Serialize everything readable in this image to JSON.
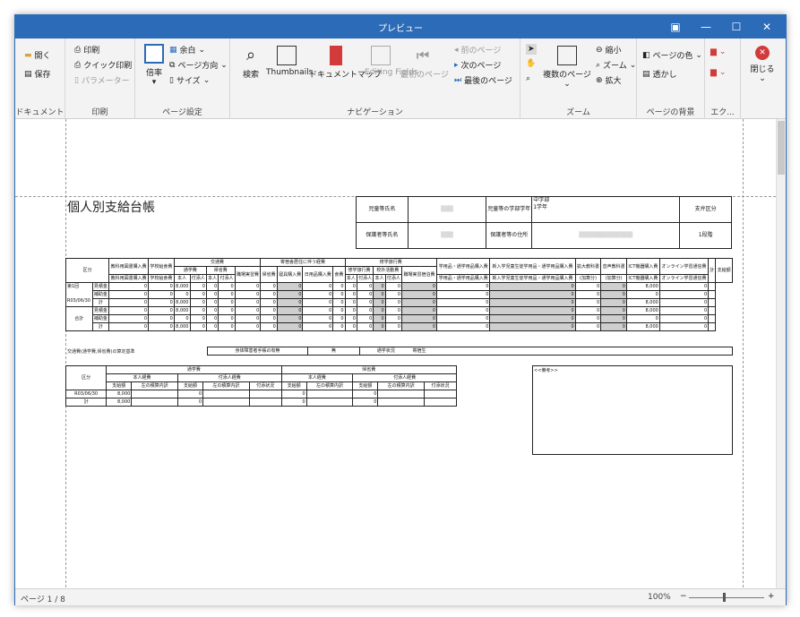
{
  "window": {
    "title": "プレビュー"
  },
  "ribbon": {
    "document": {
      "open": "開く",
      "save": "保存",
      "label": "ドキュメント"
    },
    "print": {
      "print": "印刷",
      "quick_print": "クイック印刷",
      "parameters": "パラメーター",
      "label": "印刷"
    },
    "page_setup": {
      "scale": "倍率",
      "margins": "余白",
      "orientation": "ページ方向",
      "size": "サイズ",
      "label": "ページ設定"
    },
    "navigation": {
      "search": "検索",
      "thumbnails": "Thumbnails",
      "doc_map": "ドキュメントマップ",
      "editing_fields": "Editing Fields",
      "first_page": "最初のページ",
      "prev_page": "前のページ",
      "next_page": "次のページ",
      "last_page": "最後のページ",
      "label": "ナビゲーション"
    },
    "zoom": {
      "multi_page": "複数のページ",
      "zoom_out": "縮小",
      "zoom": "ズーム",
      "zoom_in": "拡大",
      "label": "ズーム"
    },
    "background": {
      "page_color": "ページの色",
      "watermark": "透かし",
      "label": "ページの背景"
    },
    "export": {
      "label": "エク..."
    },
    "close": {
      "label": "閉じる"
    }
  },
  "report": {
    "title": "個人別支給台帳",
    "info": {
      "child_name_label": "児童等氏名",
      "grade_label": "児童等の学部学年",
      "grade_value1": "中学部",
      "grade_value2": "1学年",
      "pay_class_label": "支弁区分",
      "guardian_label": "保護者等氏名",
      "address_label": "保護者等の住所",
      "pay_class_value": "1段階"
    },
    "main_table": {
      "kubun": "区分",
      "h_textbook": "教科用図書購入費",
      "h_school_lunch": "学校給食費",
      "h_transport": "交通費",
      "h_commute": "通学費",
      "h_escort": "付添費",
      "h_principal": "本人",
      "h_attendant": "付添人",
      "h_return": "帰省費",
      "h_job": "職場実習費",
      "h_boarding": "寄宿舎居住に伴う経費",
      "h_bedding": "寝具購入費",
      "h_daily": "日用品購入費",
      "h_food": "食費",
      "h_shuji": "修学旅行費",
      "h_trip": "修学旅行費",
      "h_outside": "校外活動費",
      "h_job_lodging": "職場実習宿泊費",
      "h_supplies": "学用品・通学用品購入費",
      "h_newent": "新入学児童生徒学用品・通学用品購入費",
      "h_enlarged": "拡大教科書",
      "h_audio": "音声教科書",
      "h_ict": "ICT機器購入費",
      "h_online": "オンライン学習通信費",
      "h_total": "計",
      "h_paid": "支給額",
      "add_amount": "(加算分)",
      "first": "第1回",
      "date": "R03/06/30",
      "total": "合計",
      "r_expected": "見積金",
      "r_subsidy": "補助金",
      "r_sum": "計",
      "zero": "0",
      "amt": "8,000"
    },
    "basis": {
      "label": "交通費(通学費,帰省費)の算定基準",
      "disability": "身体障害者手帳の有無",
      "none": "無",
      "status": "通学状況",
      "status_value": "寄宿生"
    },
    "sub_table": {
      "kubun": "区分",
      "commute": "通学費",
      "return_trip": "帰省費",
      "principal": "本人経費",
      "attendant": "付添人経費",
      "paid": "支給額",
      "fare": "左の積算内訳",
      "situation": "付添状況",
      "date": "R03/06/30",
      "sum": "計",
      "amt": "8,000",
      "zero": "0"
    },
    "remarks": "<<備考>>"
  },
  "status": {
    "page": "ページ 1 / 8",
    "zoom": "100%"
  },
  "colors": {
    "titlebar": "#2b6bb8",
    "ribbon": "#f3f3f3"
  }
}
